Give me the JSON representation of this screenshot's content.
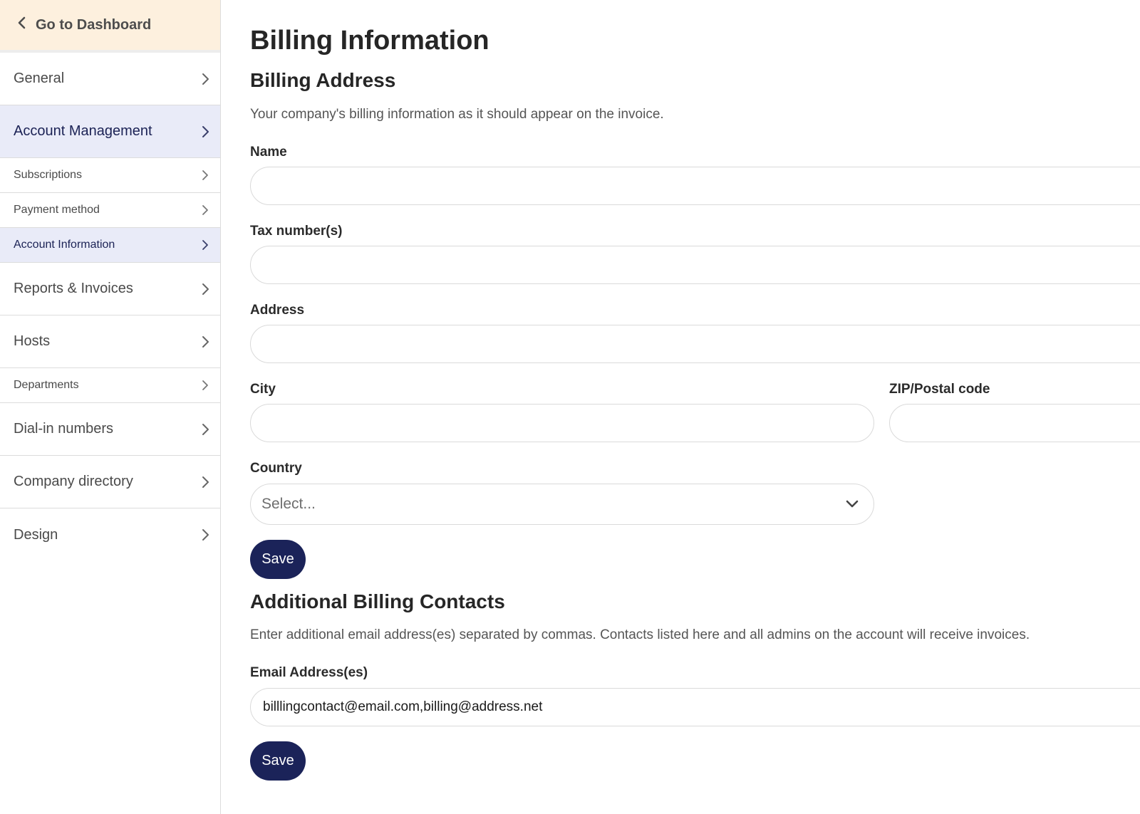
{
  "sidebar": {
    "back_label": "Go to Dashboard",
    "items": [
      {
        "label": "General"
      },
      {
        "label": "Account Management"
      },
      {
        "label": "Subscriptions"
      },
      {
        "label": "Payment method"
      },
      {
        "label": "Account Information"
      },
      {
        "label": "Reports & Invoices"
      },
      {
        "label": "Hosts"
      },
      {
        "label": "Departments"
      },
      {
        "label": "Dial-in numbers"
      },
      {
        "label": "Company directory"
      },
      {
        "label": "Design"
      }
    ]
  },
  "page": {
    "title": "Billing Information"
  },
  "billing_address": {
    "title": "Billing Address",
    "description": "Your company's billing information as it should appear on the invoice.",
    "name_label": "Name",
    "name_value": "",
    "tax_label": "Tax number(s)",
    "tax_value": "",
    "address_label": "Address",
    "address_value": "",
    "city_label": "City",
    "city_value": "",
    "zip_label": "ZIP/Postal code",
    "zip_value": "",
    "country_label": "Country",
    "country_placeholder": "Select...",
    "save_label": "Save"
  },
  "contacts": {
    "title": "Additional Billing Contacts",
    "description": "Enter additional email address(es) separated by commas. Contacts listed here and all admins on the account will receive invoices.",
    "email_label": "Email Address(es)",
    "email_value": "billlingcontact@email.com,billing@address.net",
    "save_label": "Save"
  },
  "colors": {
    "back_bg": "#fdf0de",
    "active_bg": "#e9ebf8",
    "active_text": "#1b2255",
    "button_bg": "#1b2359"
  },
  "icons": {
    "back": "chevron-left-icon",
    "nav": "chevron-right-icon",
    "select": "chevron-down-icon"
  }
}
